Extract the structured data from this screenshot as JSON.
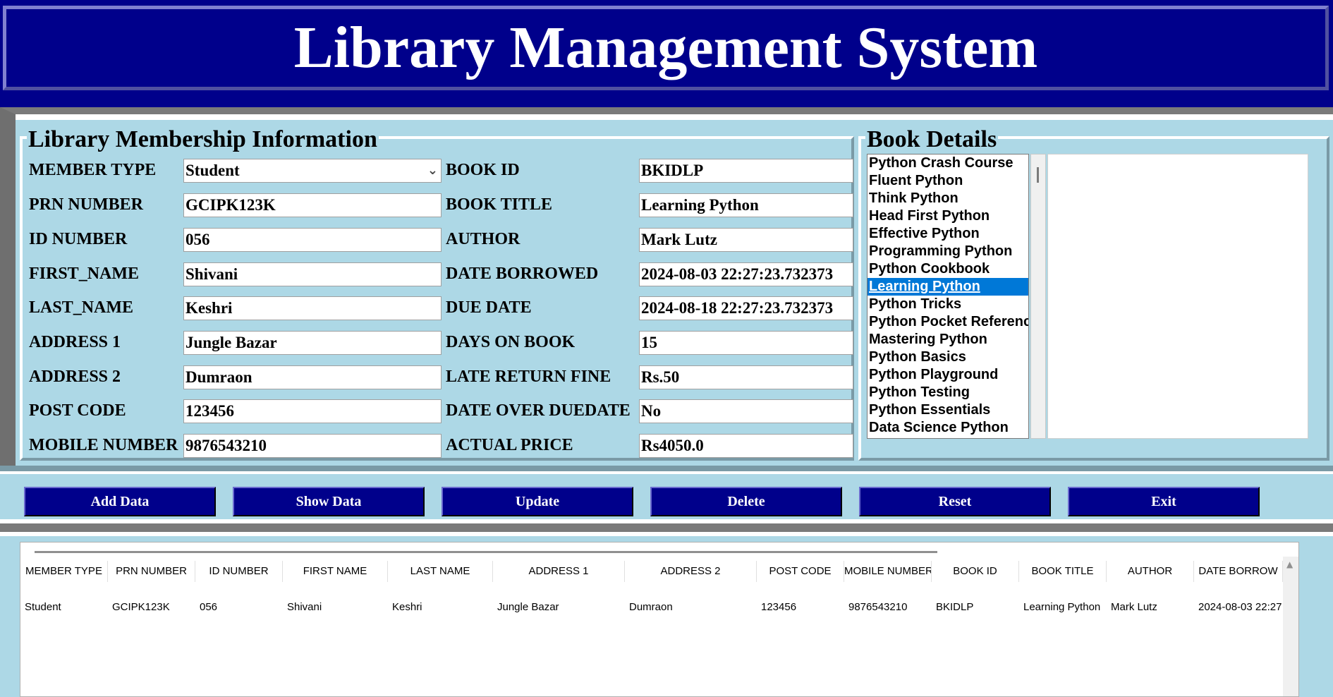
{
  "app": {
    "title": "Library Management System"
  },
  "membership": {
    "heading": "Library Membership Information",
    "member_type_label": "MEMBER TYPE",
    "member_type_value": "Student",
    "prn_label": "PRN NUMBER",
    "prn_value": "GCIPK123K",
    "id_label": "ID NUMBER",
    "id_value": "056",
    "first_name_label": "FIRST_NAME",
    "first_name_value": "Shivani",
    "last_name_label": "LAST_NAME",
    "last_name_value": "Keshri",
    "address1_label": "ADDRESS 1",
    "address1_value": "Jungle Bazar",
    "address2_label": "ADDRESS 2",
    "address2_value": "Dumraon",
    "post_code_label": "POST CODE",
    "post_code_value": "123456",
    "mobile_label": "MOBILE NUMBER",
    "mobile_value": "9876543210",
    "book_id_label": "BOOK ID",
    "book_id_value": "BKIDLP",
    "book_title_label": "BOOK TITLE",
    "book_title_value": "Learning Python",
    "author_label": "AUTHOR",
    "author_value": "Mark Lutz",
    "date_borrowed_label": "DATE BORROWED",
    "date_borrowed_value": "2024-08-03 22:27:23.732373",
    "due_date_label": "DUE DATE",
    "due_date_value": "2024-08-18 22:27:23.732373",
    "days_on_book_label": "DAYS ON BOOK",
    "days_on_book_value": "15",
    "late_fine_label": "LATE RETURN FINE",
    "late_fine_value": "Rs.50",
    "over_due_label": "DATE OVER DUEDATE",
    "over_due_value": "No",
    "actual_price_label": "ACTUAL PRICE",
    "actual_price_value": "Rs4050.0"
  },
  "book_details": {
    "heading": "Book Details",
    "books": [
      "Python Crash Course",
      "Fluent Python",
      "Think Python",
      "Head First Python",
      "Effective Python",
      "Programming Python",
      "Python Cookbook",
      "Learning Python",
      "Python Tricks",
      "Python Pocket Reference",
      "Mastering Python",
      "Python Basics",
      "Python Playground",
      "Python Testing",
      "Python Essentials",
      "Data Science Python"
    ],
    "selected": "Learning Python"
  },
  "buttons": {
    "add": "Add Data",
    "show": "Show Data",
    "update": "Update",
    "delete": "Delete",
    "reset": "Reset",
    "exit": "Exit"
  },
  "table": {
    "columns": [
      "MEMBER TYPE",
      "PRN NUMBER",
      "ID NUMBER",
      "FIRST NAME",
      "LAST NAME",
      "ADDRESS 1",
      "ADDRESS 2",
      "POST CODE",
      "MOBILE NUMBER",
      "BOOK ID",
      "BOOK TITLE",
      "AUTHOR",
      "DATE BORROW"
    ],
    "rows": [
      [
        "Student",
        "GCIPK123K",
        "056",
        "Shivani",
        "Keshri",
        "Jungle Bazar",
        "Dumraon",
        "123456",
        "9876543210",
        "BKIDLP",
        "Learning Python",
        "Mark Lutz",
        "2024-08-03 22:27"
      ]
    ]
  },
  "colors": {
    "title_bg": "#00008b",
    "panel_bg": "#add8e6",
    "button_bg": "#00008b",
    "selection": "#0078d7"
  }
}
